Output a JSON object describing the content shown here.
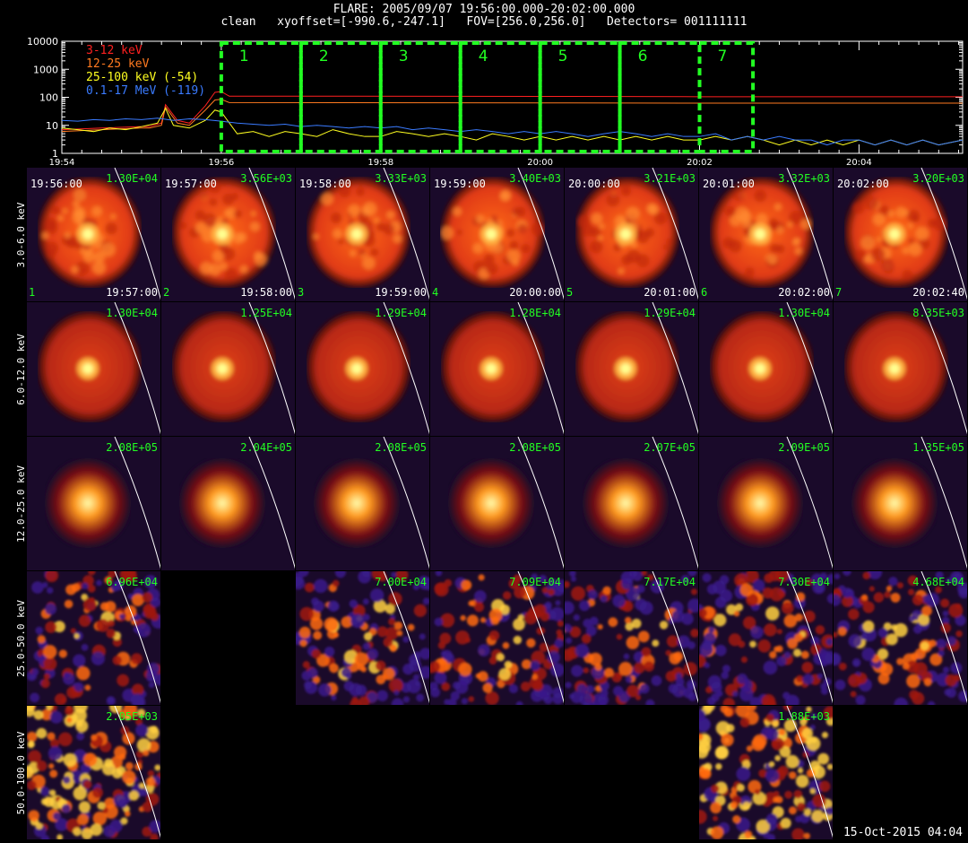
{
  "header": {
    "line1": "FLARE: 2005/09/07 19:56:00.000-20:02:00.000",
    "line2": "clean   xyoffset=[-990.6,-247.1]   FOV=[256.0,256.0]   Detectors= 001111111"
  },
  "footer": {
    "stamp": "15-Oct-2015 04:04"
  },
  "chart_data": [
    {
      "type": "line",
      "ylog": true,
      "ylim": [
        1,
        10000
      ],
      "xlim_minutes_after_1954": [
        0,
        11.3
      ],
      "yticks": [
        "10000",
        "1000",
        "100",
        "10",
        "1"
      ],
      "xticks": [
        {
          "t": 0,
          "label": "19:54"
        },
        {
          "t": 2,
          "label": "19:56"
        },
        {
          "t": 4,
          "label": "19:58"
        },
        {
          "t": 6,
          "label": "20:00"
        },
        {
          "t": 8,
          "label": "20:02"
        },
        {
          "t": 10,
          "label": "20:04"
        }
      ],
      "series": [
        {
          "name": "3-12 keV",
          "color": "#ff2020",
          "x": [
            0,
            0.5,
            1,
            1.1,
            1.25,
            1.3,
            1.45,
            1.6,
            1.8,
            1.92,
            2.0,
            2.1,
            6,
            8,
            11.3
          ],
          "y": [
            7,
            8,
            9,
            9,
            12,
            55,
            15,
            12,
            50,
            150,
            160,
            110,
            108,
            105,
            105
          ]
        },
        {
          "name": "12-25 keV",
          "color": "#ff7a20",
          "x": [
            0,
            0.5,
            1,
            1.1,
            1.25,
            1.3,
            1.45,
            1.6,
            1.8,
            1.92,
            2.0,
            2.1,
            6,
            8,
            11.3
          ],
          "y": [
            6,
            7,
            8,
            8,
            10,
            45,
            12,
            10,
            35,
            80,
            85,
            65,
            63,
            62,
            62
          ]
        },
        {
          "name": "25-100 keV (-54)",
          "color": "#ffff20",
          "x": [
            0,
            0.2,
            0.4,
            0.6,
            0.8,
            1.0,
            1.2,
            1.3,
            1.4,
            1.6,
            1.8,
            1.92,
            2.0,
            2.2,
            2.4,
            2.6,
            2.8,
            3.0,
            3.2,
            3.4,
            3.6,
            3.8,
            4.0,
            4.2,
            4.4,
            4.6,
            4.8,
            5.0,
            5.2,
            5.4,
            5.6,
            5.8,
            6.0,
            6.2,
            6.4,
            6.6,
            6.8,
            7.0,
            7.2,
            7.4,
            7.6,
            7.8,
            8.0,
            8.2,
            8.4,
            8.6,
            8.8,
            9.0,
            9.2,
            9.4,
            9.6,
            9.8,
            10.0,
            10.2,
            10.4,
            10.6,
            10.8,
            11.0,
            11.3
          ],
          "y": [
            8,
            7,
            6,
            8,
            7,
            9,
            12,
            40,
            10,
            8,
            15,
            35,
            30,
            5,
            6,
            4,
            6,
            5,
            4,
            7,
            5,
            4,
            4,
            6,
            5,
            4,
            5,
            4,
            3,
            5,
            4,
            3,
            4,
            3,
            4,
            3,
            4,
            3,
            4,
            3,
            4,
            3,
            3,
            4,
            3,
            4,
            3,
            2,
            3,
            2,
            3,
            2,
            3,
            2,
            3,
            2,
            3,
            2,
            3
          ]
        },
        {
          "name": "0.1-17 MeV (-119)",
          "color": "#3a7bff",
          "x": [
            0,
            0.2,
            0.4,
            0.6,
            0.8,
            1.0,
            1.2,
            1.4,
            1.6,
            1.8,
            2.0,
            2.2,
            2.4,
            2.6,
            2.8,
            3.0,
            3.2,
            3.4,
            3.6,
            3.8,
            4.0,
            4.2,
            4.4,
            4.6,
            4.8,
            5.0,
            5.2,
            5.4,
            5.6,
            5.8,
            6.0,
            6.2,
            6.4,
            6.6,
            6.8,
            7.0,
            7.2,
            7.4,
            7.6,
            7.8,
            8.0,
            8.2,
            8.4,
            8.6,
            8.8,
            9.0,
            9.2,
            9.4,
            9.6,
            9.8,
            10.0,
            10.2,
            10.4,
            10.6,
            10.8,
            11.0,
            11.3
          ],
          "y": [
            15,
            14,
            16,
            15,
            17,
            16,
            18,
            15,
            17,
            16,
            14,
            12,
            11,
            10,
            11,
            9,
            10,
            9,
            8,
            9,
            8,
            9,
            7,
            8,
            7,
            6,
            7,
            6,
            5,
            6,
            5,
            6,
            5,
            4,
            5,
            6,
            5,
            4,
            5,
            4,
            4,
            5,
            3,
            4,
            3,
            4,
            3,
            3,
            2,
            3,
            3,
            2,
            3,
            2,
            3,
            2,
            3
          ]
        }
      ],
      "intervals": [
        {
          "label": "1",
          "t0": 2.0,
          "t1": 3.0
        },
        {
          "label": "2",
          "t0": 3.0,
          "t1": 4.0
        },
        {
          "label": "3",
          "t0": 4.0,
          "t1": 5.0
        },
        {
          "label": "4",
          "t0": 5.0,
          "t1": 6.0
        },
        {
          "label": "5",
          "t0": 6.0,
          "t1": 7.0
        },
        {
          "label": "6",
          "t0": 7.0,
          "t1": 8.0
        },
        {
          "label": "7",
          "t0": 8.0,
          "t1": 8.67
        }
      ],
      "interval_color": "#22ff22"
    },
    {
      "type": "heatmap",
      "rows": [
        {
          "label": "3.0-6.0 keV",
          "style": "disk-bright",
          "cells": [
            {
              "col": 0,
              "max": "1.30E+04",
              "start": "19:56:00",
              "end": "19:57:00",
              "idx": "1"
            },
            {
              "col": 1,
              "max": "3.56E+03",
              "start": "19:57:00",
              "end": "19:58:00",
              "idx": "2"
            },
            {
              "col": 2,
              "max": "3.33E+03",
              "start": "19:58:00",
              "end": "19:59:00",
              "idx": "3"
            },
            {
              "col": 3,
              "max": "3.40E+03",
              "start": "19:59:00",
              "end": "20:00:00",
              "idx": "4"
            },
            {
              "col": 4,
              "max": "3.21E+03",
              "start": "20:00:00",
              "end": "20:01:00",
              "idx": "5"
            },
            {
              "col": 5,
              "max": "3.32E+03",
              "start": "20:01:00",
              "end": "20:02:00",
              "idx": "6"
            },
            {
              "col": 6,
              "max": "3.20E+03",
              "start": "20:02:00",
              "end": "20:02:40",
              "idx": "7"
            }
          ]
        },
        {
          "label": "6.0-12.0 keV",
          "style": "disk",
          "cells": [
            {
              "col": 0,
              "max": "1.30E+04"
            },
            {
              "col": 1,
              "max": "1.25E+04"
            },
            {
              "col": 2,
              "max": "1.29E+04"
            },
            {
              "col": 3,
              "max": "1.28E+04"
            },
            {
              "col": 4,
              "max": "1.29E+04"
            },
            {
              "col": 5,
              "max": "1.30E+04"
            },
            {
              "col": 6,
              "max": "8.35E+03"
            }
          ]
        },
        {
          "label": "12.0-25.0 keV",
          "style": "compact",
          "cells": [
            {
              "col": 0,
              "max": "2.08E+05"
            },
            {
              "col": 1,
              "max": "2.04E+05"
            },
            {
              "col": 2,
              "max": "2.08E+05"
            },
            {
              "col": 3,
              "max": "2.08E+05"
            },
            {
              "col": 4,
              "max": "2.07E+05"
            },
            {
              "col": 5,
              "max": "2.09E+05"
            },
            {
              "col": 6,
              "max": "1.35E+05"
            }
          ]
        },
        {
          "label": "25.0-50.0 keV",
          "style": "noisy",
          "cells": [
            {
              "col": 0,
              "max": "6.96E+04"
            },
            {
              "col": 2,
              "max": "7.00E+04"
            },
            {
              "col": 3,
              "max": "7.09E+04"
            },
            {
              "col": 4,
              "max": "7.17E+04"
            },
            {
              "col": 5,
              "max": "7.30E+04"
            },
            {
              "col": 6,
              "max": "4.68E+04"
            }
          ]
        },
        {
          "label": "50.0-100.0 keV",
          "style": "very-noisy",
          "cells": [
            {
              "col": 0,
              "max": "2.05E+03"
            },
            {
              "col": 5,
              "max": "1.88E+03"
            }
          ]
        }
      ]
    }
  ]
}
